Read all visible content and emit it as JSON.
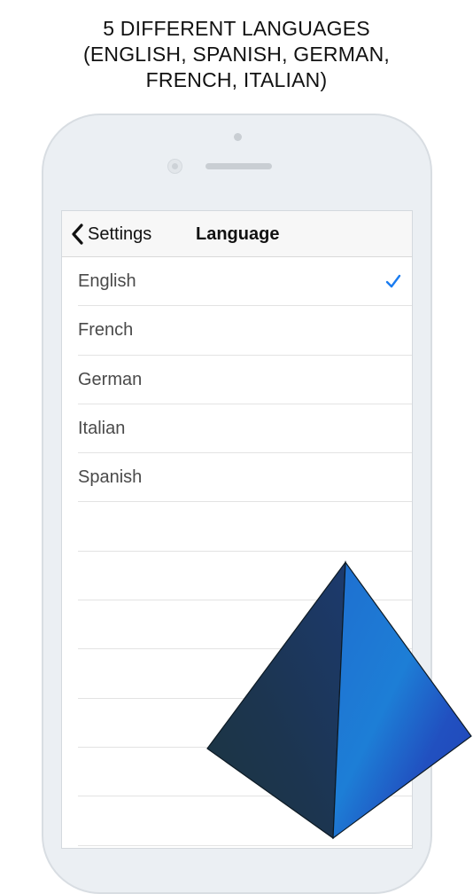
{
  "headline": {
    "line1": "5 DIFFERENT LANGUAGES",
    "line2": "(ENGLISH, SPANISH, GERMAN,",
    "line3": "FRENCH, ITALIAN)"
  },
  "navbar": {
    "back_label": "Settings",
    "title": "Language",
    "back_icon": "chevron-left-icon"
  },
  "languages": [
    {
      "label": "English",
      "selected": true
    },
    {
      "label": "French",
      "selected": false
    },
    {
      "label": "German",
      "selected": false
    },
    {
      "label": "Italian",
      "selected": false
    },
    {
      "label": "Spanish",
      "selected": false
    }
  ],
  "icons": {
    "check": "checkmark-icon",
    "logo": "pyramid-logo"
  },
  "colors": {
    "accent": "#1a7cf0",
    "pyramid_left_top": "#1c3a6e",
    "pyramid_left_bottom": "#1b3540",
    "pyramid_right_top": "#1f6fd0",
    "pyramid_right_bottom": "#2245b8"
  }
}
